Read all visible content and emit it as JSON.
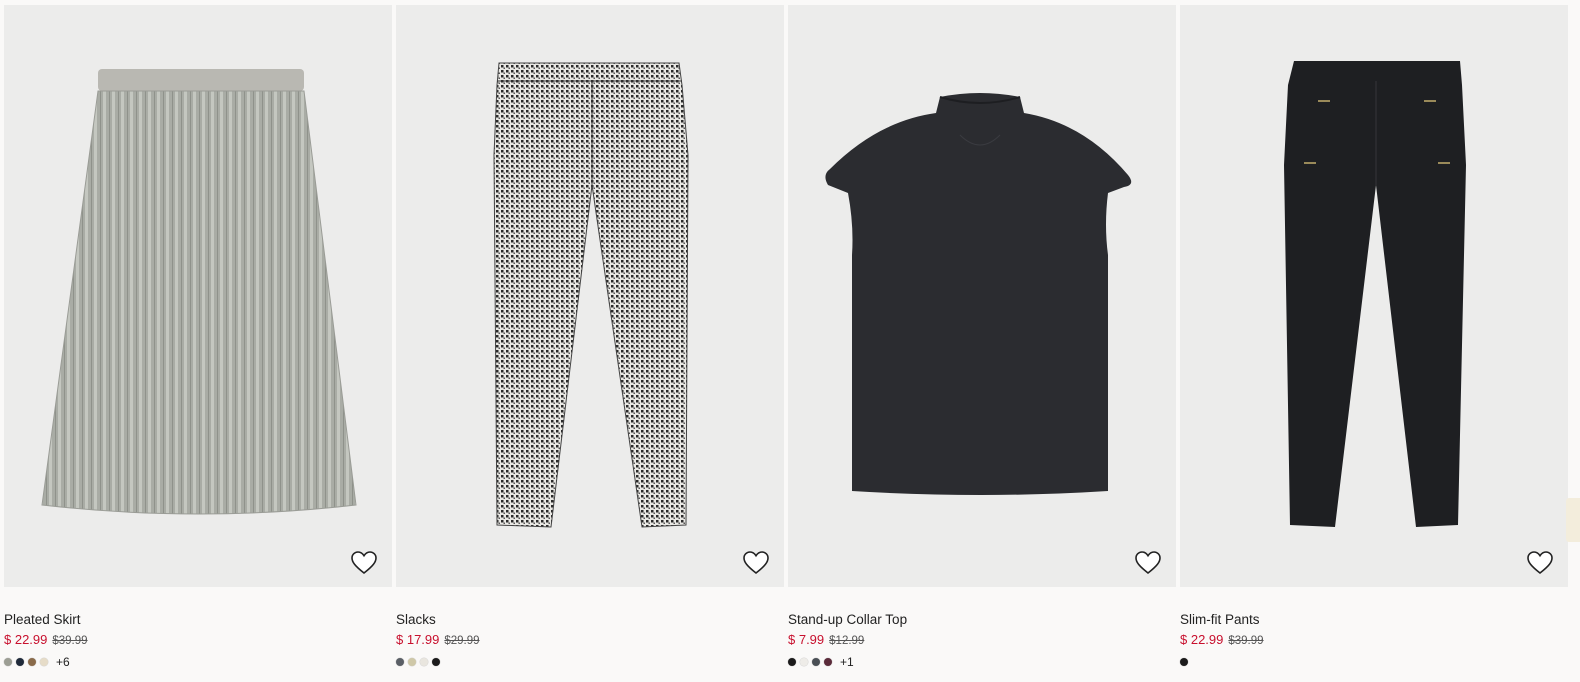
{
  "products": [
    {
      "name": "Pleated Skirt",
      "sale_price": "$ 22.99",
      "original_price": "$39.99",
      "swatches": [
        "#9c9e94",
        "#1f2a3a",
        "#8a6b4a",
        "#e6dcc8"
      ],
      "more_colors": "+6",
      "favorite_icon": "heart-outline-icon"
    },
    {
      "name": "Slacks",
      "sale_price": "$ 17.99",
      "original_price": "$29.99",
      "swatches": [
        "#5a5f66",
        "#cfc8a8",
        "#e9e6df",
        "#1b1b1b"
      ],
      "more_colors": "",
      "favorite_icon": "heart-outline-icon"
    },
    {
      "name": "Stand-up Collar Top",
      "sale_price": "$ 7.99",
      "original_price": "$12.99",
      "swatches": [
        "#1b1b1b",
        "#eeece8",
        "#4a4f55",
        "#5b2b3a"
      ],
      "more_colors": "+1",
      "favorite_icon": "heart-outline-icon"
    },
    {
      "name": "Slim-fit Pants",
      "sale_price": "$ 22.99",
      "original_price": "$39.99",
      "swatches": [
        "#1b1b1b"
      ],
      "more_colors": "",
      "favorite_icon": "heart-outline-icon"
    }
  ],
  "colors": {
    "sale": "#c8102e",
    "image_background": "#ececeb",
    "page_background": "#faf9f8"
  }
}
